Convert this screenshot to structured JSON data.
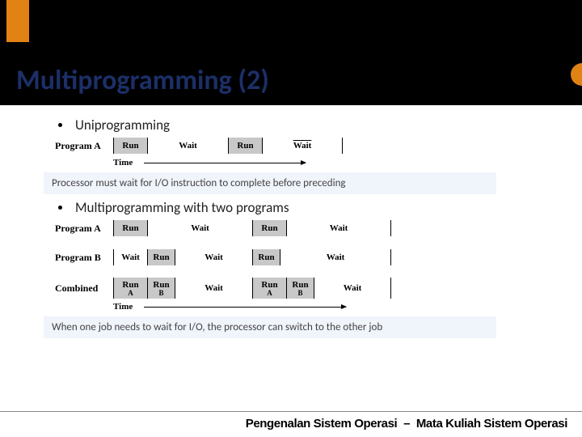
{
  "title": "Multiprogramming (2)",
  "uni": {
    "heading": "Uniprogramming",
    "label": "Program A",
    "segments": [
      "Run",
      "Wait",
      "Run",
      "Wait"
    ],
    "timeLabel": "Time",
    "note": "Processor must wait for I/O instruction to complete before preceding"
  },
  "multi": {
    "heading": "Multiprogramming with two programs",
    "rowA": {
      "label": "Program A",
      "segments": [
        "Run",
        "Wait",
        "Run",
        "Wait"
      ]
    },
    "rowB": {
      "label": "Program B",
      "segments": [
        "Wait",
        "Run",
        "Wait",
        "Run",
        "Wait"
      ]
    },
    "rowC": {
      "label": "Combined",
      "segments": [
        {
          "top": "Run",
          "sub": "A"
        },
        {
          "top": "Run",
          "sub": "B"
        },
        {
          "top": "",
          "full": "Wait"
        },
        {
          "top": "Run",
          "sub": "A"
        },
        {
          "top": "Run",
          "sub": "B"
        },
        {
          "top": "",
          "full": "Wait"
        }
      ]
    },
    "timeLabel": "Time",
    "note": "When one job needs to wait for I/O, the processor can switch to the other job"
  },
  "footer": {
    "left": "Pengenalan Sistem Operasi",
    "sep": "–",
    "right": "Mata Kuliah Sistem Operasi"
  }
}
